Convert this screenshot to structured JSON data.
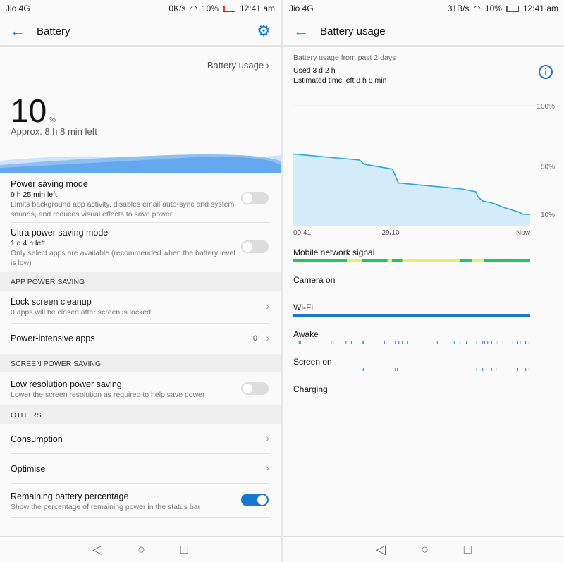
{
  "status_left": {
    "carrier": "Jio 4G",
    "speed": "0K/s",
    "battery": "10%",
    "time": "12:41 am"
  },
  "status_right": {
    "carrier": "Jio 4G",
    "speed": "31B/s",
    "battery": "10%",
    "time": "12:41 am"
  },
  "battery": {
    "title": "Battery",
    "usage_link": "Battery usage",
    "level": "10",
    "unit": "%",
    "approx": "Approx. 8 h 8 min left",
    "power_saving": {
      "title": "Power saving mode",
      "sub": "9 h 25 min left",
      "desc": "Limits background app activity, disables email auto-sync and system sounds, and reduces visual effects to save power",
      "on": false
    },
    "ultra": {
      "title": "Ultra power saving mode",
      "sub": "1 d 4 h left",
      "desc": "Only select apps are available (recommended when the battery level is low)",
      "on": false
    },
    "sec_app": "APP POWER SAVING",
    "lock": {
      "title": "Lock screen cleanup",
      "desc": "0 apps will be closed after screen is locked"
    },
    "intensive": {
      "title": "Power-intensive apps",
      "count": "0"
    },
    "sec_screen": "SCREEN POWER SAVING",
    "lowres": {
      "title": "Low resolution power saving",
      "desc": "Lower the screen resolution as required to help save power",
      "on": false
    },
    "sec_others": "OTHERS",
    "consumption": "Consumption",
    "optimise": "Optimise",
    "remaining": {
      "title": "Remaining battery percentage",
      "desc": "Show the percentage of remaining power in the status bar",
      "on": true
    }
  },
  "usage": {
    "title": "Battery usage",
    "period": "Battery usage from past 2 days",
    "used": "Used 3 d 2 h",
    "estimated": "Estimated time left 8 h 8 min",
    "labels": {
      "signal": "Mobile network signal",
      "camera": "Camera on",
      "wifi": "Wi-Fi",
      "awake": "Awake",
      "screen": "Screen on",
      "charging": "Charging"
    }
  },
  "colors": {
    "accent": "#1976d2",
    "line": "#29a8d8",
    "fill": "#d4ecfa",
    "signal_good": "#22c55e",
    "signal_fair": "#e2f06a",
    "wifi": "#1976d2"
  },
  "chart_data": {
    "type": "area",
    "xlabel": "",
    "ylabel": "",
    "x_unit": "hours since 00:41",
    "xlim": [
      0,
      48
    ],
    "ylim": [
      0,
      100
    ],
    "x_ticks": [
      "00:41",
      "29/10",
      "Now"
    ],
    "y_ticks": [
      "100%",
      "50%",
      "10%"
    ],
    "points": [
      [
        0,
        60
      ],
      [
        13.4,
        55
      ],
      [
        14.4,
        51.5
      ],
      [
        20.1,
        47.5
      ],
      [
        21.3,
        36
      ],
      [
        34.1,
        31
      ],
      [
        37,
        28.7
      ],
      [
        37.4,
        24.5
      ],
      [
        38.4,
        21
      ],
      [
        40.6,
        19
      ],
      [
        42.4,
        16
      ],
      [
        45.6,
        12
      ],
      [
        46.6,
        10
      ],
      [
        48,
        10
      ]
    ],
    "signal": [
      [
        0,
        10.9,
        "good"
      ],
      [
        10.9,
        13.9,
        "fair"
      ],
      [
        13.9,
        19.1,
        "good"
      ],
      [
        19.1,
        20,
        "fair"
      ],
      [
        20,
        22.1,
        "good"
      ],
      [
        22.1,
        33.7,
        "fair"
      ],
      [
        33.7,
        36.3,
        "good"
      ],
      [
        36.3,
        38.6,
        "fair"
      ],
      [
        38.6,
        48,
        "good"
      ]
    ],
    "wifi": [
      [
        0,
        48
      ]
    ],
    "awake": [
      1.1,
      1.4,
      7.6,
      8,
      10.6,
      11.7,
      13.9,
      14.1,
      18.4,
      20.6,
      21.3,
      22,
      23.1,
      29.1,
      32.3,
      32.6,
      33.7,
      35,
      37.1,
      38.3,
      38.7,
      39.3,
      40.1,
      41,
      41.4,
      42.4,
      44.4,
      45.4,
      45.9,
      47,
      47.7
    ],
    "screen": [
      14.1,
      20.6,
      21,
      37.1,
      38.3,
      40.1,
      41,
      45.4,
      47,
      47.7
    ]
  }
}
